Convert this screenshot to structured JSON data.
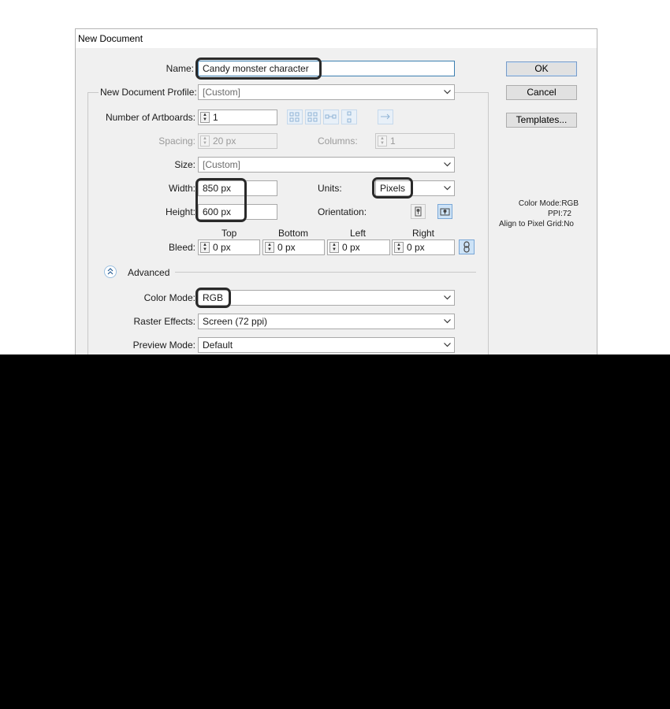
{
  "window": {
    "title": "New Document"
  },
  "name": {
    "label": "Name:",
    "value": "Candy monster character"
  },
  "profile": {
    "label": "New Document Profile:",
    "value": "[Custom]"
  },
  "artboards": {
    "label": "Number of Artboards:",
    "value": "1"
  },
  "spacing": {
    "label": "Spacing:",
    "value": "20 px"
  },
  "columns": {
    "label": "Columns:",
    "value": "1"
  },
  "size": {
    "label": "Size:",
    "value": "[Custom]"
  },
  "width": {
    "label": "Width:",
    "value": "850 px"
  },
  "height": {
    "label": "Height:",
    "value": "600 px"
  },
  "units": {
    "label": "Units:",
    "value": "Pixels"
  },
  "orientation": {
    "label": "Orientation:"
  },
  "bleed": {
    "label": "Bleed:",
    "top_label": "Top",
    "bottom_label": "Bottom",
    "left_label": "Left",
    "right_label": "Right",
    "top": "0 px",
    "bottom": "0 px",
    "left": "0 px",
    "right": "0 px"
  },
  "advanced": {
    "label": "Advanced"
  },
  "color_mode": {
    "label": "Color Mode:",
    "value": "RGB"
  },
  "raster_effects": {
    "label": "Raster Effects:",
    "value": "Screen (72 ppi)"
  },
  "preview_mode": {
    "label": "Preview Mode:",
    "value": "Default"
  },
  "buttons": {
    "ok": "OK",
    "cancel": "Cancel",
    "templates": "Templates..."
  },
  "info": {
    "line1": "Color Mode:RGB",
    "line2": "PPI:72",
    "line3": "Align to Pixel Grid:No"
  },
  "colors": {
    "highlight": "#2a2a2a",
    "focus": "#3c7fb1",
    "dialog_bg": "#f0f0f0"
  }
}
